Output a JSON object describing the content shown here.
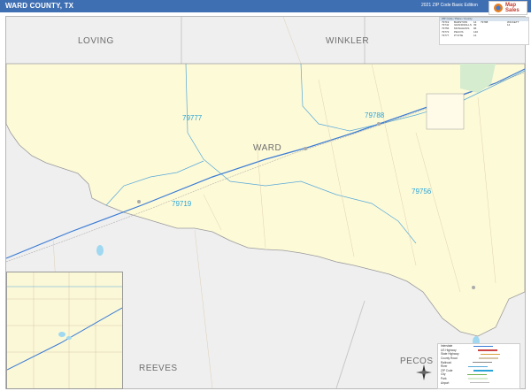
{
  "header": {
    "title": "WARD COUNTY, TX",
    "edition": "2021 ZIP Code Basic Edition"
  },
  "logo": {
    "brand": "Map Sales"
  },
  "counties": {
    "loving": "LOVING",
    "winkler": "WINKLER",
    "ward": "WARD",
    "reeves": "REEVES",
    "pecos": "PECOS"
  },
  "zips": [
    "79777",
    "79788",
    "79756",
    "79719"
  ],
  "zip_table": {
    "header": "ZIP Code / Place / County",
    "rows": [
      [
        "79719",
        "BARSTOW",
        "14"
      ],
      [
        "79742",
        "GRANDFALLS",
        "39"
      ],
      [
        "79756",
        "MONAHANS",
        "96"
      ],
      [
        "79772",
        "PECOS",
        "140"
      ],
      [
        "79777",
        "PYOTE",
        "14"
      ]
    ],
    "extra": [
      "79788",
      "WICKETT",
      "14"
    ]
  },
  "legend_rows": [
    "Interstate",
    "US Highway",
    "State Highway",
    "County Road",
    "Railroad",
    "River",
    "ZIP Code",
    "City",
    "Park",
    "Airport",
    "County Line",
    "Land Area",
    "Water Area",
    "Scale"
  ],
  "colors": {
    "land": "#fdfad8",
    "outside": "#efefef",
    "zip_label": "#29a4d8",
    "header_bar": "#3f6fb3",
    "highway": "#3a7bd5",
    "water": "#9fd8f0"
  }
}
